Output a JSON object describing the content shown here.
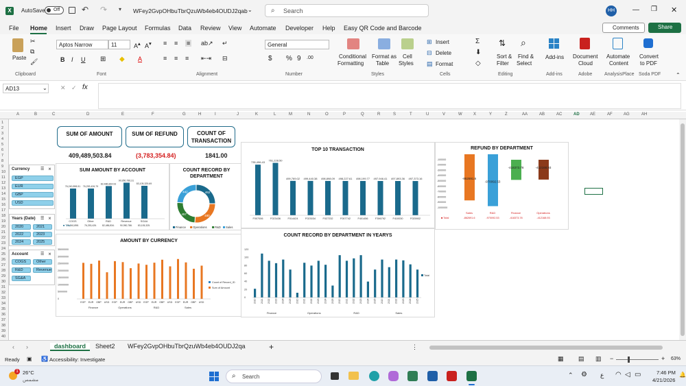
{
  "titlebar": {
    "autosave": "AutoSave",
    "autosave_state": "Off",
    "filename": "WFey2GvpOHbuTbrQzuWb4eb4OUDJ2qab",
    "search_placeholder": "Search",
    "avatar": "HH"
  },
  "menu": {
    "items": [
      "File",
      "Home",
      "Insert",
      "Draw",
      "Page Layout",
      "Formulas",
      "Data",
      "Review",
      "View",
      "Automate",
      "Developer",
      "Help",
      "Easy QR Code and Barcode"
    ],
    "comments": "Comments",
    "share": "Share"
  },
  "ribbon": {
    "paste": "Paste",
    "clipboard": "Clipboard",
    "font_name": "Aptos Narrow",
    "font_size": "11",
    "font": "Font",
    "alignment": "Alignment",
    "number_format": "General",
    "number": "Number",
    "cond1": "Conditional",
    "cond2": "Formatting",
    "fmt1": "Format as",
    "fmt2": "Table",
    "cell1": "Cell",
    "cell2": "Styles",
    "styles": "Styles",
    "insert": "Insert",
    "delete": "Delete",
    "format": "Format",
    "cells": "Cells",
    "sort1": "Sort &",
    "sort2": "Filter",
    "find1": "Find &",
    "find2": "Select",
    "editing": "Editing",
    "addins": "Add-ins",
    "addins_grp": "Add-ins",
    "doc1": "Document",
    "doc2": "Cloud",
    "adobe": "Adobe",
    "auto1": "Automate",
    "auto2": "Content",
    "analysis": "AnalysisPlace",
    "conv1": "Convert",
    "conv2": "to PDF",
    "soda": "Soda PDF"
  },
  "formula": {
    "namebox": "AD13",
    "fx": "fx"
  },
  "columns": [
    "A",
    "B",
    "C",
    "D",
    "E",
    "F",
    "G",
    "H",
    "I",
    "J",
    "K",
    "L",
    "M",
    "N",
    "O",
    "P",
    "Q",
    "R",
    "S",
    "T",
    "U",
    "V",
    "W",
    "X",
    "Y",
    "Z",
    "AA",
    "AB",
    "AC",
    "AD",
    "AE",
    "AF",
    "AG",
    "AH"
  ],
  "rows": [
    "1",
    "2",
    "3",
    "4",
    "5",
    "6",
    "7",
    "8",
    "9",
    "10",
    "11",
    "12",
    "13",
    "14",
    "15",
    "16",
    "17",
    "18",
    "19",
    "20",
    "21",
    "22",
    "23",
    "24",
    "25",
    "26",
    "27",
    "28",
    "29",
    "30",
    "31",
    "32",
    "33",
    "34",
    "35",
    "36",
    "37",
    "38",
    "39",
    "40"
  ],
  "kpis": [
    {
      "label1": "SUM OF AMOUNT",
      "label2": "",
      "value": "409,489,503.84",
      "color": "#111111"
    },
    {
      "label1": "SUM OF REFUND",
      "label2": "",
      "value": "(3,783,354.84)",
      "color": "#d42020"
    },
    {
      "label1": "COUNT OF",
      "label2": "TRANSACTION",
      "value": "1841.00",
      "color": "#111111"
    }
  ],
  "slicers": {
    "currency": {
      "title": "Currency",
      "items": [
        "EGP",
        "EUR",
        "GBP",
        "USD"
      ]
    },
    "years": {
      "title": "Years (Date)",
      "items": [
        "2020",
        "2021",
        "2022",
        "2023",
        "2024",
        "2025"
      ]
    },
    "account": {
      "title": "Account",
      "items": [
        "COGS",
        "Other",
        "R&D",
        "Revenue",
        "SG&A"
      ]
    }
  },
  "chart_data": [
    {
      "id": "sum_amount_by_account",
      "type": "bar",
      "title": "SUM AMOUNT BY ACCOUNT",
      "categories": [
        "COGS",
        "Other",
        "R&D",
        "Revenue",
        "SG&A"
      ],
      "values": [
        76240898.91,
        76253426.79,
        82486834.93,
        90950786.31,
        83105325.69
      ],
      "labels": [
        "76,240,898.91",
        "76,253,426.79",
        "82,486,834.93",
        "90,950,786.31",
        "83,105,325.69"
      ],
      "table_label": "Total",
      "table_values": [
        "76,240,898.",
        "76,253,426.",
        "82,486,834.",
        "90,950,786.",
        "83,105,325."
      ]
    },
    {
      "id": "count_by_department",
      "type": "pie",
      "title": "COUNT RECORD BY DEPARTMENT",
      "categories": [
        "Finance",
        "Operations",
        "R&D",
        "Sales"
      ],
      "values": [
        462,
        480,
        457,
        442
      ],
      "labels": [
        "462",
        "480",
        "457",
        "442"
      ],
      "colors": [
        "#1a6a8c",
        "#e87722",
        "#2e7d32",
        "#3aa0d8"
      ]
    },
    {
      "id": "top10",
      "type": "bar",
      "title": "TOP 10 TRANSACTION",
      "categories": [
        "F007006",
        "F023436",
        "F014424",
        "F023034",
        "F027232",
        "F007742",
        "F401456",
        "F396792",
        "F410030",
        "F025902"
      ],
      "values": [
        735496.43,
        761228.5,
        499769.02,
        499440.38,
        498898.09,
        498227.61,
        498199.77,
        497946.41,
        497893.36,
        497373.16
      ],
      "labels": [
        "735,496.43",
        "761,228.50",
        "499,769.02",
        "499,440.38",
        "498,898.09",
        "498,227.61",
        "498,199.77",
        "497,946.41",
        "497,893.36",
        "497,373.16"
      ]
    },
    {
      "id": "refund_by_department",
      "type": "bar",
      "title": "REFUND BY DEPARTMENT",
      "categories": [
        "Sales",
        "R&D",
        "Finance",
        "Operations"
      ],
      "values": [
        -862691.6,
        -970092.53,
        -418373.78,
        -412168.93
      ],
      "labels": [
        "-862691.6",
        "-970092.53",
        "-418373.78",
        "-412168.93"
      ],
      "table_label": "Total",
      "table_values": [
        "-862691.6",
        "-970092.53",
        "-418373.78",
        "-412168.93"
      ],
      "ylim": [
        -1000000,
        0
      ],
      "yticks": [
        "-100000",
        "-200000",
        "-300000",
        "-400000",
        "-500000",
        "-600000",
        "-700000",
        "-800000",
        "-900000",
        "-1000000"
      ],
      "colors": [
        "#e87722",
        "#3aa0d8",
        "#4caf50",
        "#8b3a1a"
      ]
    },
    {
      "id": "amount_by_currency",
      "type": "bar",
      "title": "AMOUNT BY CURRENCY",
      "groups": [
        "Finance",
        "Operations",
        "R&D",
        "Sales"
      ],
      "categories": [
        "EGP",
        "EUR",
        "GBP",
        "USD",
        "EGP",
        "EUR",
        "GBP",
        "USD",
        "EGP",
        "EUR",
        "GBP",
        "USD",
        "EGP",
        "EUR",
        "GBP",
        "USD"
      ],
      "series": [
        {
          "name": "Count of Record_ID",
          "values": [
            120,
            115,
            110,
            108,
            119,
            112,
            117,
            114,
            116,
            109,
            118,
            111,
            121,
            113,
            110,
            107
          ]
        },
        {
          "name": "Sum of Amount",
          "values": [
            25600000,
            24900000,
            27200000,
            18900000,
            26800000,
            26100000,
            21800000,
            25100000,
            24200000,
            25700000,
            27800000,
            23100000,
            28300000,
            25900000,
            21400000,
            23600000
          ]
        }
      ],
      "yticks": [
        "35000000",
        "30000000",
        "25000000",
        "20000000",
        "15000000",
        "10000000",
        "5000000",
        "0"
      ],
      "colors": [
        "#2b83c6",
        "#e87722"
      ]
    },
    {
      "id": "count_by_dept_years",
      "type": "bar",
      "title": "COUNT RECORD BY DEPARTMENT IN YEARYS",
      "groups": [
        "Finance",
        "Operations",
        "R&D",
        "Sales"
      ],
      "categories": [
        "2020",
        "2021",
        "2022",
        "2023",
        "2024",
        "2025"
      ],
      "values": [
        22,
        110,
        92,
        86,
        95,
        70,
        12,
        87,
        80,
        92,
        82,
        30,
        106,
        92,
        98,
        106,
        40,
        70,
        95,
        76,
        95,
        93,
        83,
        70
      ],
      "yticks": [
        "120",
        "100",
        "80",
        "60",
        "40",
        "20",
        "0"
      ],
      "legend": "Total"
    }
  ],
  "sheet_tabs": [
    "dashboard",
    "Sheet2",
    "WFey2GvpOHbuTbrQzuWb4eb4OUDJ2qa"
  ],
  "status": {
    "ready": "Ready",
    "accessibility": "Accessibility: Investigate",
    "zoom": "63%"
  },
  "taskbar": {
    "temp": "26°C",
    "weather": "مشمس",
    "search": "Search",
    "time": "7:46 PM",
    "date": "4/21/2026",
    "lang": "ع"
  }
}
